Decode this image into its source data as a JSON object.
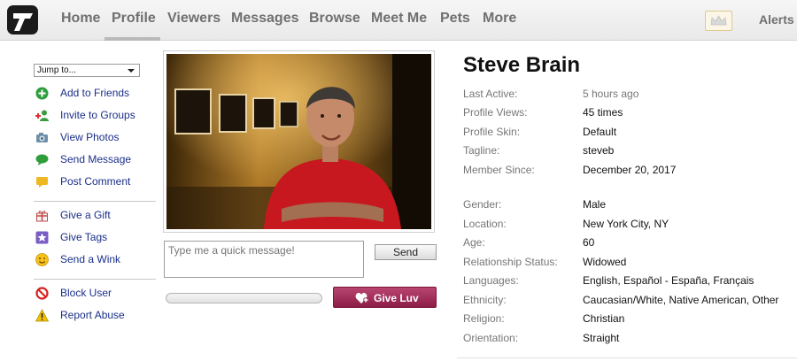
{
  "nav": {
    "items": [
      "Home",
      "Profile",
      "Viewers",
      "Messages",
      "Browse",
      "Meet Me",
      "Pets",
      "More"
    ],
    "active": "Profile",
    "alerts_label": "Alerts"
  },
  "sidebar": {
    "jump_select": "Jump to...",
    "group1": [
      {
        "label": "Add to Friends",
        "icon": "plus-circle-icon"
      },
      {
        "label": "Invite to Groups",
        "icon": "add-people-icon"
      },
      {
        "label": "View Photos",
        "icon": "camera-icon"
      },
      {
        "label": "Send Message",
        "icon": "speech-bubble-icon"
      },
      {
        "label": "Post Comment",
        "icon": "comment-icon"
      }
    ],
    "group2": [
      {
        "label": "Give a Gift",
        "icon": "gift-icon"
      },
      {
        "label": "Give Tags",
        "icon": "star-tag-icon"
      },
      {
        "label": "Send a Wink",
        "icon": "wink-smiley-icon"
      }
    ],
    "group3": [
      {
        "label": "Block User",
        "icon": "block-icon"
      },
      {
        "label": "Report Abuse",
        "icon": "warning-icon"
      }
    ]
  },
  "message": {
    "placeholder": "Type me a quick message!",
    "send_label": "Send"
  },
  "luv": {
    "button_label": "Give Luv",
    "progress": 0
  },
  "profile": {
    "name": "Steve Brain",
    "group1": [
      {
        "label": "Last Active:",
        "value": "5 hours ago"
      },
      {
        "label": "Profile Views:",
        "value": "45 times"
      },
      {
        "label": "Profile Skin:",
        "value": "Default"
      },
      {
        "label": "Tagline:",
        "value": "steveb"
      },
      {
        "label": "Member Since:",
        "value": "December 20, 2017"
      }
    ],
    "group2": [
      {
        "label": "Gender:",
        "value": "Male"
      },
      {
        "label": "Location:",
        "value": "New York City, NY"
      },
      {
        "label": "Age:",
        "value": "60"
      },
      {
        "label": "Relationship Status:",
        "value": "Widowed"
      },
      {
        "label": "Languages:",
        "value": "English, Español - España, Français"
      },
      {
        "label": "Ethnicity:",
        "value": "Caucasian/White, Native American, Other"
      },
      {
        "label": "Religion:",
        "value": "Christian"
      },
      {
        "label": "Orientation:",
        "value": "Straight"
      }
    ]
  },
  "colors": {
    "nav_text": "#707070",
    "link": "#1a2f8a",
    "luv_button": "#9e2b55"
  }
}
